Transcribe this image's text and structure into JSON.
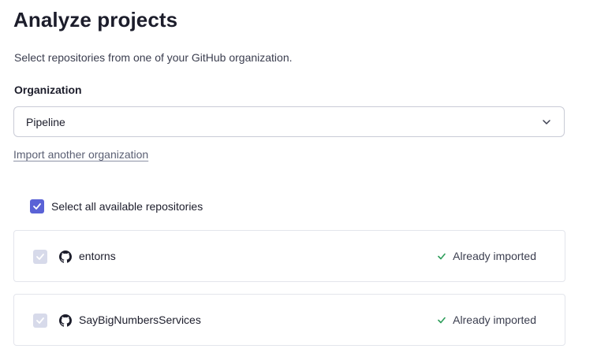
{
  "header": {
    "title": "Analyze projects",
    "subtitle": "Select repositories from one of your GitHub organization."
  },
  "organization": {
    "label": "Organization",
    "selected": "Pipeline",
    "import_link": "Import another organization"
  },
  "select_all": {
    "label": "Select all available repositories",
    "checked": true
  },
  "repositories": [
    {
      "name": "entorns",
      "status": "Already imported",
      "checked": true,
      "disabled": true
    },
    {
      "name": "SayBigNumbersServices",
      "status": "Already imported",
      "checked": true,
      "disabled": true
    }
  ],
  "colors": {
    "accent": "#5a62d6",
    "disabled_checkbox": "#d7daea",
    "success_check": "#2e9e5b",
    "border": "#e3e5ec"
  },
  "icons": {
    "chevron": "chevron-down-icon",
    "github": "github-icon",
    "check": "check-icon"
  }
}
